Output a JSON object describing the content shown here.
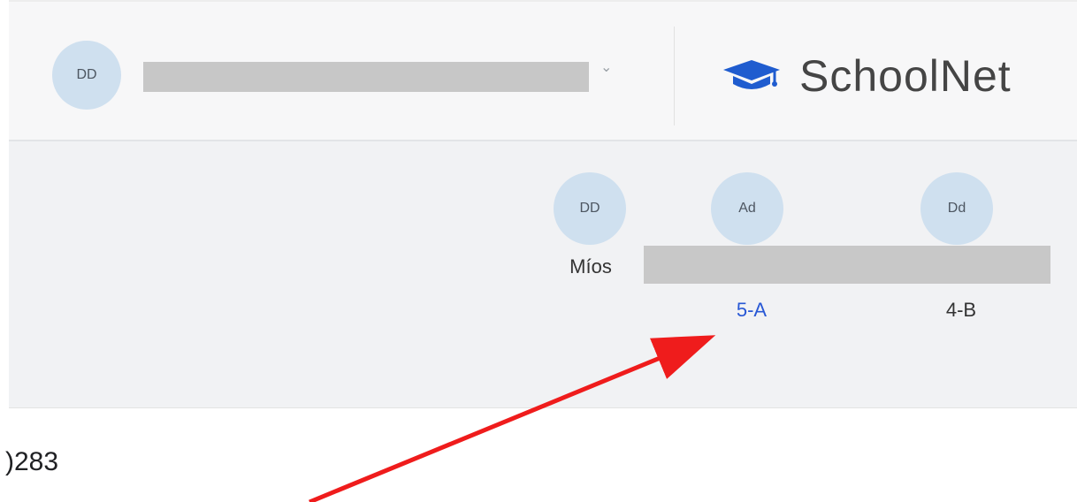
{
  "header": {
    "user_avatar_initials": "DD",
    "user_menu_chevron": "⌄",
    "brand": {
      "name": "SchoolNet",
      "icon": "graduation-cap-icon",
      "icon_color": "#1f5ccf"
    }
  },
  "profiles": [
    {
      "initials": "DD",
      "label": "Míos"
    },
    {
      "initials": "Ad",
      "group": "5-A"
    },
    {
      "initials": "Dd",
      "group": "4-B"
    }
  ],
  "content": {
    "code_fragment": ")283"
  },
  "colors": {
    "avatar_background": "#cfe0ef",
    "link_blue": "#2858d5",
    "annotation_red": "#ef1c1c"
  }
}
